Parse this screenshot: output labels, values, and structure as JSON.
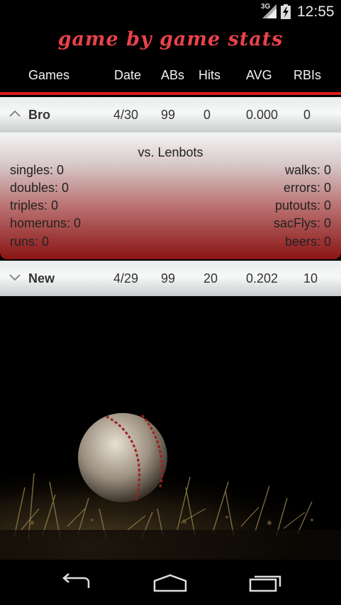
{
  "status_bar": {
    "network_label": "3G",
    "time": "12:55",
    "icons": [
      "signal-icon",
      "battery-charging-icon"
    ]
  },
  "title": "game by game stats",
  "columns": {
    "games": "Games",
    "date": "Date",
    "abs": "ABs",
    "hits": "Hits",
    "avg": "AVG",
    "rbis": "RBIs"
  },
  "games": [
    {
      "name": "Bro",
      "date": "4/30",
      "abs": "99",
      "hits": "0",
      "avg": "0.000",
      "rbis": "0",
      "expanded": true,
      "chevron_icon": "chevron-up-icon"
    },
    {
      "name": "New",
      "date": "4/29",
      "abs": "99",
      "hits": "20",
      "avg": "0.202",
      "rbis": "10",
      "expanded": false,
      "chevron_icon": "chevron-down-icon"
    }
  ],
  "details": {
    "opponent": "vs. Lenbots",
    "left_stats": [
      "singles: 0",
      "doubles: 0",
      "triples: 0",
      "homeruns: 0",
      "runs: 0"
    ],
    "right_stats": [
      "walks: 0",
      "errors: 0",
      "putouts: 0",
      "sacFlys: 0",
      "beers: 0"
    ]
  },
  "nav": {
    "icons": [
      "back-icon",
      "home-icon",
      "recent-apps-icon"
    ]
  },
  "colors": {
    "title": "#e8424a",
    "accent_rule": "#e11a1a",
    "details_bottom": "#8a1414"
  }
}
